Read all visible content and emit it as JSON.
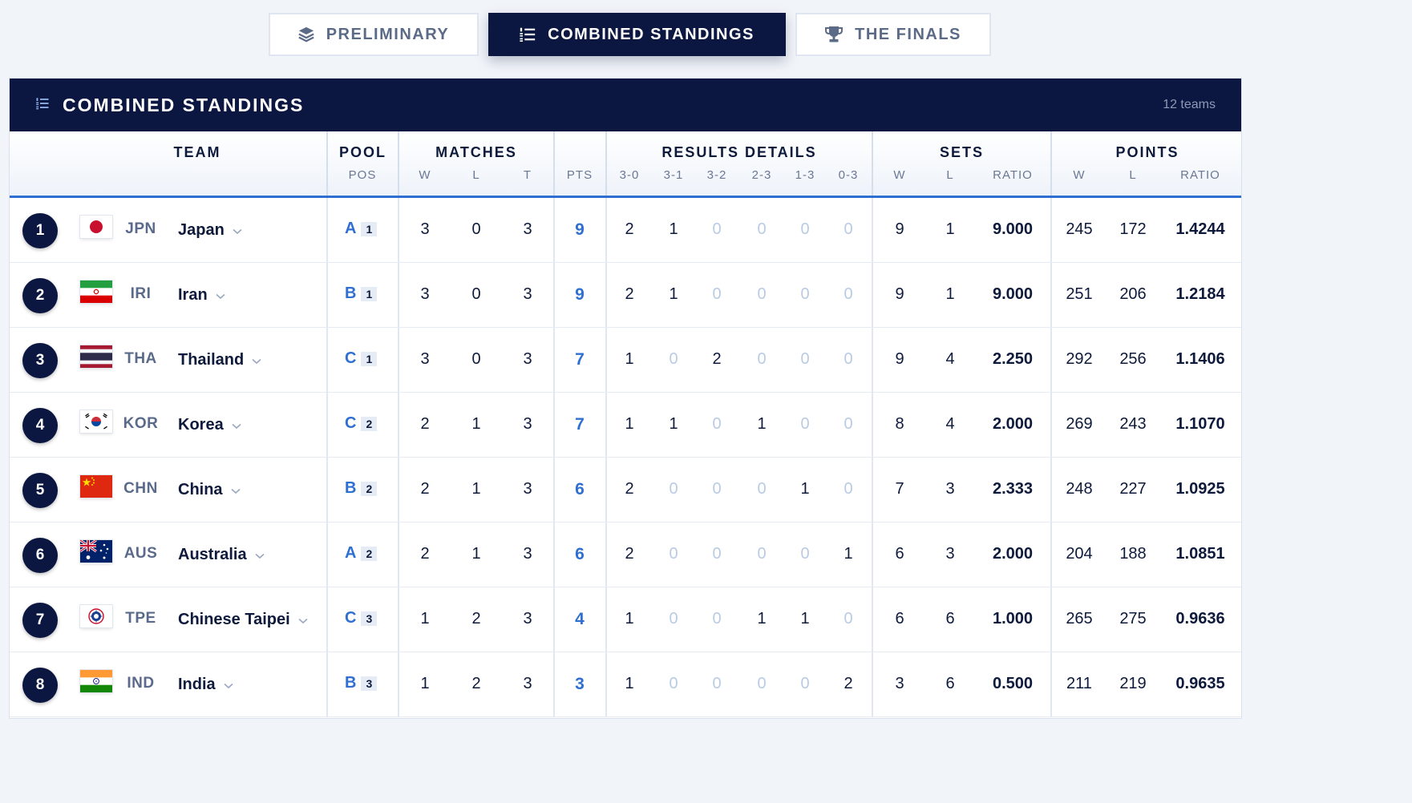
{
  "tabs": [
    {
      "label": "PRELIMINARY",
      "icon": "layers-icon",
      "active": false
    },
    {
      "label": "COMBINED STANDINGS",
      "icon": "list-ordered-icon",
      "active": true
    },
    {
      "label": "THE FINALS",
      "icon": "trophy-icon",
      "active": false
    }
  ],
  "panel": {
    "title": "COMBINED STANDINGS",
    "count": "12 teams"
  },
  "columns": {
    "team": "TEAM",
    "pool": "POOL",
    "pool_sub": "POS",
    "matches": "MATCHES",
    "matches_w": "W",
    "matches_l": "L",
    "matches_t": "T",
    "pts": "PTS",
    "results": "RESULTS DETAILS",
    "r30": "3-0",
    "r31": "3-1",
    "r32": "3-2",
    "r23": "2-3",
    "r13": "1-3",
    "r03": "0-3",
    "sets": "SETS",
    "sets_w": "W",
    "sets_l": "L",
    "sets_ratio": "RATIO",
    "points": "POINTS",
    "points_w": "W",
    "points_l": "L",
    "points_ratio": "RATIO"
  },
  "colors": {
    "navy": "#0b1740",
    "accent": "#2f6fd1",
    "zero": "#b9cbe3"
  },
  "rows": [
    {
      "rank": "1",
      "flag": "jpn",
      "code": "JPN",
      "name": "Japan",
      "pool": "A",
      "pos": "1",
      "w": "3",
      "l": "0",
      "t": "3",
      "pts": "9",
      "r30": "2",
      "r31": "1",
      "r32": "0",
      "r23": "0",
      "r13": "0",
      "r03": "0",
      "sw": "9",
      "sl": "1",
      "sratio": "9.000",
      "pw": "245",
      "pl": "172",
      "pratio": "1.4244"
    },
    {
      "rank": "2",
      "flag": "iri",
      "code": "IRI",
      "name": "Iran",
      "pool": "B",
      "pos": "1",
      "w": "3",
      "l": "0",
      "t": "3",
      "pts": "9",
      "r30": "2",
      "r31": "1",
      "r32": "0",
      "r23": "0",
      "r13": "0",
      "r03": "0",
      "sw": "9",
      "sl": "1",
      "sratio": "9.000",
      "pw": "251",
      "pl": "206",
      "pratio": "1.2184"
    },
    {
      "rank": "3",
      "flag": "tha",
      "code": "THA",
      "name": "Thailand",
      "pool": "C",
      "pos": "1",
      "w": "3",
      "l": "0",
      "t": "3",
      "pts": "7",
      "r30": "1",
      "r31": "0",
      "r32": "2",
      "r23": "0",
      "r13": "0",
      "r03": "0",
      "sw": "9",
      "sl": "4",
      "sratio": "2.250",
      "pw": "292",
      "pl": "256",
      "pratio": "1.1406"
    },
    {
      "rank": "4",
      "flag": "kor",
      "code": "KOR",
      "name": "Korea",
      "pool": "C",
      "pos": "2",
      "w": "2",
      "l": "1",
      "t": "3",
      "pts": "7",
      "r30": "1",
      "r31": "1",
      "r32": "0",
      "r23": "1",
      "r13": "0",
      "r03": "0",
      "sw": "8",
      "sl": "4",
      "sratio": "2.000",
      "pw": "269",
      "pl": "243",
      "pratio": "1.1070"
    },
    {
      "rank": "5",
      "flag": "chn",
      "code": "CHN",
      "name": "China",
      "pool": "B",
      "pos": "2",
      "w": "2",
      "l": "1",
      "t": "3",
      "pts": "6",
      "r30": "2",
      "r31": "0",
      "r32": "0",
      "r23": "0",
      "r13": "1",
      "r03": "0",
      "sw": "7",
      "sl": "3",
      "sratio": "2.333",
      "pw": "248",
      "pl": "227",
      "pratio": "1.0925"
    },
    {
      "rank": "6",
      "flag": "aus",
      "code": "AUS",
      "name": "Australia",
      "pool": "A",
      "pos": "2",
      "w": "2",
      "l": "1",
      "t": "3",
      "pts": "6",
      "r30": "2",
      "r31": "0",
      "r32": "0",
      "r23": "0",
      "r13": "0",
      "r03": "1",
      "sw": "6",
      "sl": "3",
      "sratio": "2.000",
      "pw": "204",
      "pl": "188",
      "pratio": "1.0851"
    },
    {
      "rank": "7",
      "flag": "tpe",
      "code": "TPE",
      "name": "Chinese Taipei",
      "pool": "C",
      "pos": "3",
      "w": "1",
      "l": "2",
      "t": "3",
      "pts": "4",
      "r30": "1",
      "r31": "0",
      "r32": "0",
      "r23": "1",
      "r13": "1",
      "r03": "0",
      "sw": "6",
      "sl": "6",
      "sratio": "1.000",
      "pw": "265",
      "pl": "275",
      "pratio": "0.9636"
    },
    {
      "rank": "8",
      "flag": "ind",
      "code": "IND",
      "name": "India",
      "pool": "B",
      "pos": "3",
      "w": "1",
      "l": "2",
      "t": "3",
      "pts": "3",
      "r30": "1",
      "r31": "0",
      "r32": "0",
      "r23": "0",
      "r13": "0",
      "r03": "2",
      "sw": "3",
      "sl": "6",
      "sratio": "0.500",
      "pw": "211",
      "pl": "219",
      "pratio": "0.9635"
    }
  ]
}
